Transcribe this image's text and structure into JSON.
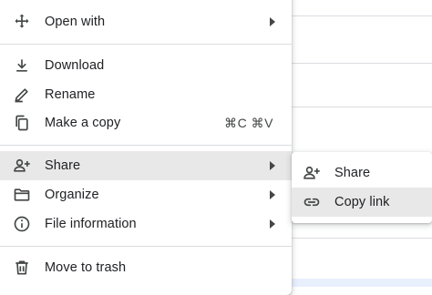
{
  "main_menu": {
    "open_with": "Open with",
    "download": "Download",
    "rename": "Rename",
    "make_copy": "Make a copy",
    "make_copy_shortcut": "⌘C ⌘V",
    "share": "Share",
    "organize": "Organize",
    "file_information": "File information",
    "move_to_trash": "Move to trash"
  },
  "share_submenu": {
    "share": "Share",
    "copy_link": "Copy link"
  },
  "icons": {
    "open_with": "move-arrows-icon",
    "download": "download-icon",
    "rename": "pencil-icon",
    "make_copy": "copy-icon",
    "share": "person-add-icon",
    "organize": "folder-icon",
    "file_information": "info-icon",
    "move_to_trash": "trash-icon",
    "copy_link": "link-icon"
  },
  "colors": {
    "active_item_bg": "#e8e8e8",
    "text": "#202124",
    "divider": "#dadce0"
  }
}
